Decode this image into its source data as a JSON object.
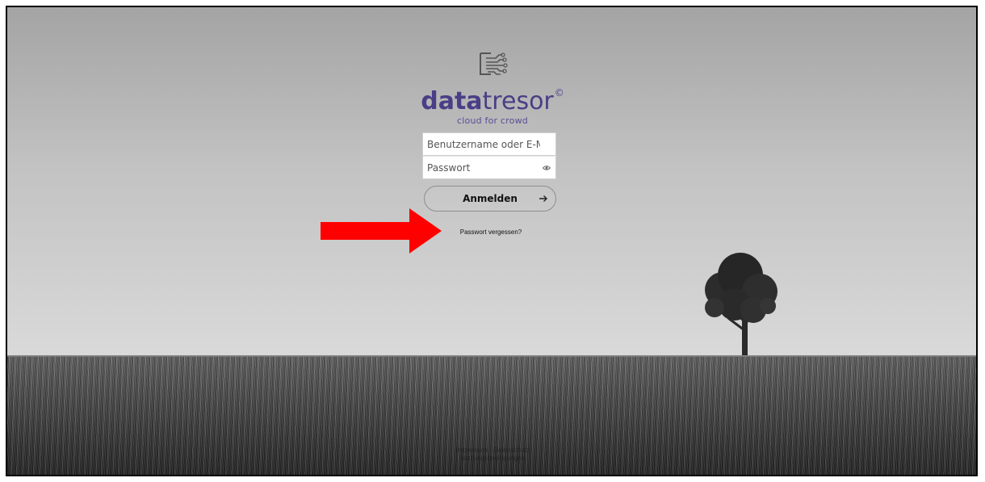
{
  "brand": {
    "name_bold": "data",
    "name_light": "tresor",
    "copyright_mark": "©",
    "tagline": "cloud for crowd",
    "color": "#4a3e86",
    "icon": "circuit-document-icon"
  },
  "login": {
    "username_placeholder": "Benutzername oder E-Mail",
    "password_placeholder": "Passwort",
    "show_password_icon": "eye-icon",
    "submit_label": "Anmelden",
    "submit_icon": "arrow-right-icon",
    "forgot_password": "Passwort vergessen?"
  },
  "annotation": {
    "pointer_color": "#ff0000",
    "pointer_icon": "red-arrow-right"
  },
  "footer": {
    "line1": "Impressum · Datenschutz",
    "line2": "Nutzungsbedingungen"
  }
}
